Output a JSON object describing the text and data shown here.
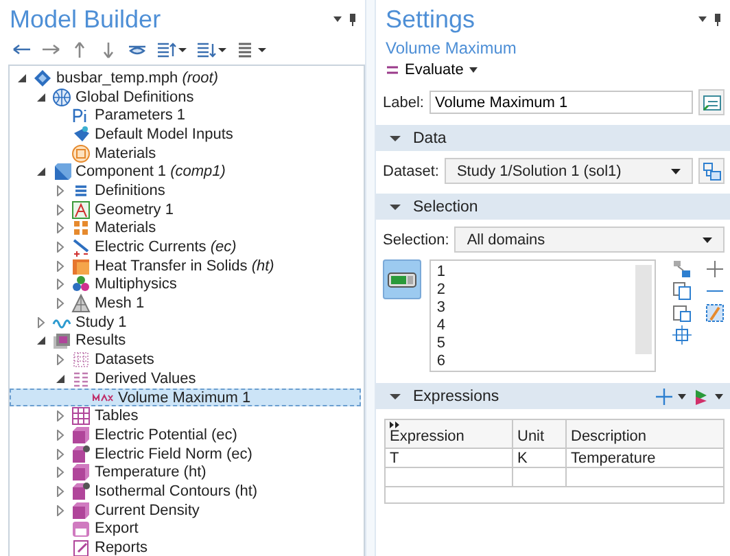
{
  "model_builder": {
    "title": "Model Builder",
    "toolbar": [
      {
        "kind": "back",
        "dropdown": false
      },
      {
        "kind": "forward",
        "dropdown": false
      },
      {
        "kind": "up",
        "dropdown": false
      },
      {
        "kind": "down",
        "dropdown": false
      },
      {
        "kind": "eye",
        "dropdown": false
      },
      {
        "kind": "sort-up",
        "dropdown": true
      },
      {
        "kind": "sort-down",
        "dropdown": true
      },
      {
        "kind": "list",
        "dropdown": true
      }
    ],
    "tree": [
      {
        "label": "busbar_temp.mph *(root)*",
        "kind": "file",
        "expandable": true,
        "expanded": true,
        "selected": false,
        "children": [
          {
            "label": "Global Definitions",
            "kind": "globe",
            "expandable": true,
            "expanded": true,
            "selected": false,
            "children": [
              {
                "label": "Parameters 1",
                "kind": "param",
                "expandable": false,
                "selected": false
              },
              {
                "label": "Default Model Inputs",
                "kind": "inputs",
                "expandable": false,
                "selected": false
              },
              {
                "label": "Materials",
                "kind": "material-global",
                "expandable": false,
                "selected": false
              }
            ]
          },
          {
            "label": "Component 1 *(comp1)*",
            "kind": "component",
            "expandable": true,
            "expanded": true,
            "selected": false,
            "children": [
              {
                "label": "Definitions",
                "kind": "definitions",
                "expandable": true,
                "expanded": false,
                "selected": false
              },
              {
                "label": "Geometry 1",
                "kind": "geometry",
                "expandable": true,
                "expanded": false,
                "selected": false
              },
              {
                "label": "Materials",
                "kind": "materials",
                "expandable": true,
                "expanded": false,
                "selected": false
              },
              {
                "label": "Electric Currents *(ec)*",
                "kind": "physics-ec",
                "expandable": true,
                "expanded": false,
                "selected": false
              },
              {
                "label": "Heat Transfer in Solids *(ht)*",
                "kind": "physics-ht",
                "expandable": true,
                "expanded": false,
                "selected": false
              },
              {
                "label": "Multiphysics",
                "kind": "multiphysics",
                "expandable": true,
                "expanded": false,
                "selected": false
              },
              {
                "label": "Mesh 1",
                "kind": "mesh",
                "expandable": true,
                "expanded": false,
                "selected": false
              }
            ]
          },
          {
            "label": "Study 1",
            "kind": "study",
            "expandable": true,
            "expanded": false,
            "selected": false
          },
          {
            "label": "Results",
            "kind": "results",
            "expandable": true,
            "expanded": true,
            "selected": false,
            "children": [
              {
                "label": "Datasets",
                "kind": "datasets",
                "expandable": true,
                "expanded": false,
                "selected": false
              },
              {
                "label": "Derived Values",
                "kind": "derived",
                "expandable": true,
                "expanded": true,
                "selected": false,
                "children": [
                  {
                    "label": "Volume Maximum 1",
                    "kind": "max",
                    "expandable": false,
                    "selected": true
                  }
                ]
              },
              {
                "label": "Tables",
                "kind": "tables",
                "expandable": true,
                "expanded": false,
                "selected": false
              },
              {
                "label": "Electric Potential (ec)",
                "kind": "plot",
                "expandable": true,
                "expanded": false,
                "selected": false
              },
              {
                "label": "Electric Field Norm (ec)",
                "kind": "plot-star",
                "expandable": true,
                "expanded": false,
                "selected": false
              },
              {
                "label": "Temperature (ht)",
                "kind": "plot",
                "expandable": true,
                "expanded": false,
                "selected": false
              },
              {
                "label": "Isothermal Contours (ht)",
                "kind": "plot-star",
                "expandable": true,
                "expanded": false,
                "selected": false
              },
              {
                "label": "Current Density",
                "kind": "plot",
                "expandable": true,
                "expanded": false,
                "selected": false
              },
              {
                "label": "Export",
                "kind": "export",
                "expandable": false,
                "selected": false
              },
              {
                "label": "Reports",
                "kind": "reports",
                "expandable": false,
                "selected": false
              }
            ]
          }
        ]
      }
    ]
  },
  "settings": {
    "title": "Settings",
    "subtitle": "Volume Maximum",
    "evaluate": "Evaluate",
    "label": {
      "caption": "Label:",
      "value": "Volume Maximum 1"
    },
    "sections": [
      {
        "kind": "data",
        "title": "Data",
        "expanded": true,
        "caption": "Dataset:",
        "value": "Study 1/Solution 1 (sol1)"
      },
      {
        "kind": "selection",
        "title": "Selection",
        "expanded": true,
        "caption": "Selection:",
        "value": "All domains",
        "active": true,
        "items": [
          "1",
          "2",
          "3",
          "4",
          "5",
          "6"
        ]
      },
      {
        "kind": "expressions",
        "title": "Expressions",
        "expanded": true,
        "columns": [
          "Expression",
          "Unit",
          "Description"
        ],
        "rows": [
          [
            "T",
            "K",
            "Temperature"
          ],
          [
            "",
            "",
            ""
          ]
        ]
      }
    ]
  }
}
